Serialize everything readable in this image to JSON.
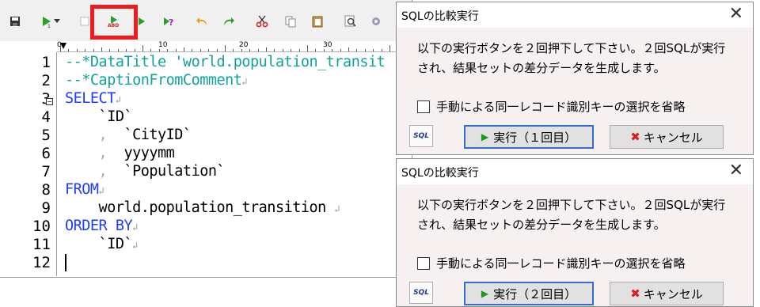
{
  "editor": {
    "ruler_labels": [
      "0",
      "10",
      "20",
      "30"
    ],
    "line_numbers": [
      "1",
      "2",
      "3",
      "4",
      "5",
      "6",
      "7",
      "8",
      "9",
      "10",
      "11",
      "12"
    ],
    "lines": [
      {
        "parts": [
          {
            "cls": "cmt",
            "t": "--*DataTitle 'world.population_transit"
          }
        ]
      },
      {
        "parts": [
          {
            "cls": "cmt",
            "t": "--*CaptionFromComment"
          },
          {
            "cls": "ret",
            "t": "↲"
          }
        ]
      },
      {
        "parts": [
          {
            "cls": "kw",
            "t": "SELECT"
          },
          {
            "cls": "ret",
            "t": "↲"
          }
        ]
      },
      {
        "parts": [
          {
            "cls": "txt",
            "t": "    `ID`"
          }
        ]
      },
      {
        "parts": [
          {
            "cls": "comma",
            "t": "    ,  "
          },
          {
            "cls": "txt",
            "t": "`CityID`"
          }
        ]
      },
      {
        "parts": [
          {
            "cls": "comma",
            "t": "    ,  "
          },
          {
            "cls": "txt",
            "t": "yyyymm"
          }
        ]
      },
      {
        "parts": [
          {
            "cls": "comma",
            "t": "    ,  "
          },
          {
            "cls": "txt",
            "t": "`Population`"
          }
        ]
      },
      {
        "parts": [
          {
            "cls": "kw",
            "t": "FROM"
          },
          {
            "cls": "ret",
            "t": "↲"
          }
        ]
      },
      {
        "parts": [
          {
            "cls": "txt",
            "t": "    world.population_transition "
          },
          {
            "cls": "ret",
            "t": "↲"
          }
        ]
      },
      {
        "parts": [
          {
            "cls": "kw",
            "t": "ORDER BY"
          },
          {
            "cls": "ret",
            "t": "↲"
          }
        ]
      },
      {
        "parts": [
          {
            "cls": "txt",
            "t": "    `ID`"
          },
          {
            "cls": "ret",
            "t": "↲"
          }
        ]
      },
      {
        "parts": []
      }
    ]
  },
  "toolbar": {
    "icons": [
      "save-icon",
      "run-icon",
      "dropdown-arrow-icon",
      "stop-icon",
      "run-diff-icon",
      "run-step-icon",
      "help-run-icon",
      "undo-icon",
      "redo-icon",
      "cut-icon",
      "copy-icon",
      "paste-icon",
      "find-icon",
      "settings-icon"
    ]
  },
  "dialog1": {
    "title": "SQLの比較実行",
    "close": "✕",
    "message": "以下の実行ボタンを２回押下して下さい。２回SQLが実行され、結果セットの差分データを生成します。",
    "checkbox_label": "手動による同一レコード識別キーの選択を省略",
    "sql_label": "SQL",
    "run_label": "実行（１回目）",
    "cancel_label": "キャンセル"
  },
  "dialog2": {
    "title": "SQLの比較実行",
    "close": "✕",
    "message": "以下の実行ボタンを２回押下して下さい。２回SQLが実行され、結果セットの差分データを生成します。",
    "checkbox_label": "手動による同一レコード識別キーの選択を省略",
    "sql_label": "SQL",
    "run_label": "実行（２回目）",
    "cancel_label": "キャンセル"
  }
}
